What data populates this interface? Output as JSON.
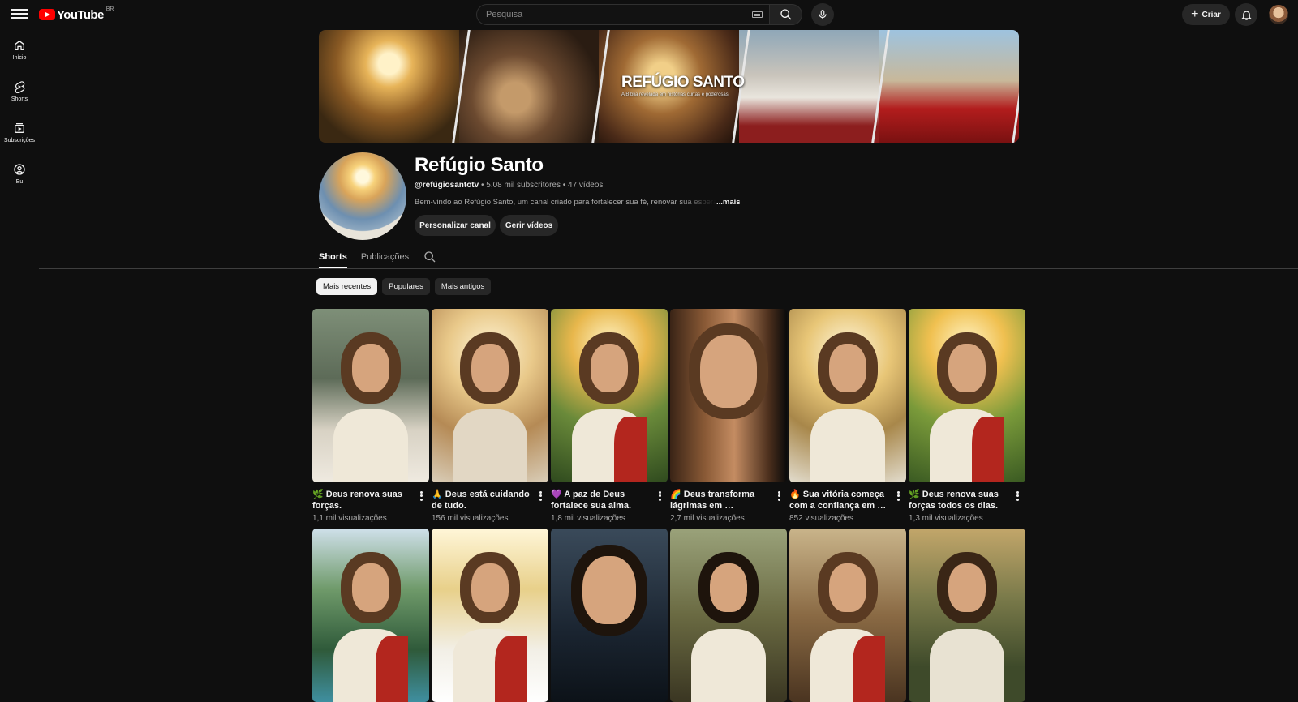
{
  "header": {
    "logo_text": "YouTube",
    "country_code": "BR",
    "search_placeholder": "Pesquisa",
    "create_label": "Criar"
  },
  "sidebar": {
    "items": [
      {
        "label": "Início",
        "icon": "home-icon"
      },
      {
        "label": "Shorts",
        "icon": "shorts-icon"
      },
      {
        "label": "Subscrições",
        "icon": "subscriptions-icon"
      },
      {
        "label": "Eu",
        "icon": "user-circle-icon"
      }
    ]
  },
  "banner": {
    "title": "REFÚGIO SANTO",
    "subtitle": "A Bíblia revelada em histórias curtas e poderosas"
  },
  "channel": {
    "name": "Refúgio Santo",
    "handle": "@refúgiosantotv",
    "subscribers": "5,08 mil subscritores",
    "videos": "47 vídeos",
    "description": "Bem-vindo ao Refúgio Santo, um canal criado para fortalecer sua fé, renovar sua esperança",
    "more_label": "...mais",
    "customize_label": "Personalizar canal",
    "manage_label": "Gerir vídeos"
  },
  "tabs": [
    {
      "label": "Shorts",
      "active": true
    },
    {
      "label": "Publicações",
      "active": false
    }
  ],
  "chips": [
    {
      "label": "Mais recentes",
      "active": true
    },
    {
      "label": "Populares",
      "active": false
    },
    {
      "label": "Mais antigos",
      "active": false
    }
  ],
  "shorts": [
    {
      "title": "🌿 Deus renova suas forças.",
      "views": "1,1 mil visualizações"
    },
    {
      "title": "🙏 Deus está cuidando de tudo.",
      "views": "156 mil visualizações"
    },
    {
      "title": "💜 A paz de Deus fortalece sua alma.",
      "views": "1,8 mil visualizações"
    },
    {
      "title": "🌈 Deus transforma lágrimas em …",
      "views": "2,7 mil visualizações"
    },
    {
      "title": "🔥 Sua vitória começa com a confiança em …",
      "views": "852 visualizações"
    },
    {
      "title": "🌿 Deus renova suas forças todos os dias.",
      "views": "1,3 mil visualizações"
    },
    {
      "title": "",
      "views": ""
    },
    {
      "title": "",
      "views": ""
    },
    {
      "title": "",
      "views": ""
    },
    {
      "title": "",
      "views": ""
    },
    {
      "title": "",
      "views": ""
    },
    {
      "title": "",
      "views": ""
    }
  ],
  "colors": {
    "background": "#0f0f0f",
    "brand_red": "#ff0000",
    "chip_active": "#f1f1f1",
    "chip_bg": "#272727"
  }
}
